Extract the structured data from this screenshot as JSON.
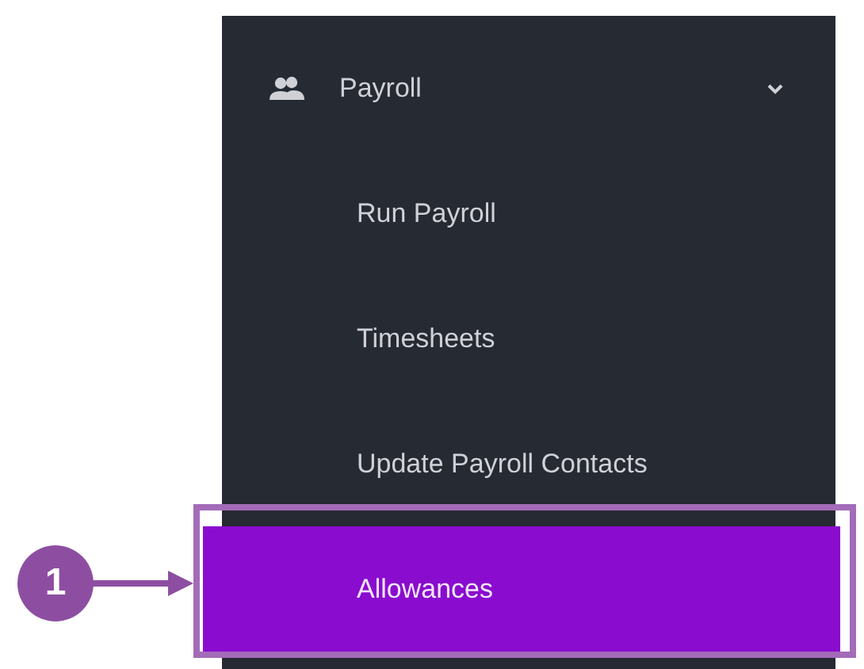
{
  "menu": {
    "label": "Payroll",
    "expanded": true,
    "children": [
      {
        "label": "Run Payroll",
        "selected": false
      },
      {
        "label": "Timesheets",
        "selected": false
      },
      {
        "label": "Update Payroll Contacts",
        "selected": false
      },
      {
        "label": "Allowances",
        "selected": true
      }
    ]
  },
  "callout": {
    "label": "1"
  }
}
